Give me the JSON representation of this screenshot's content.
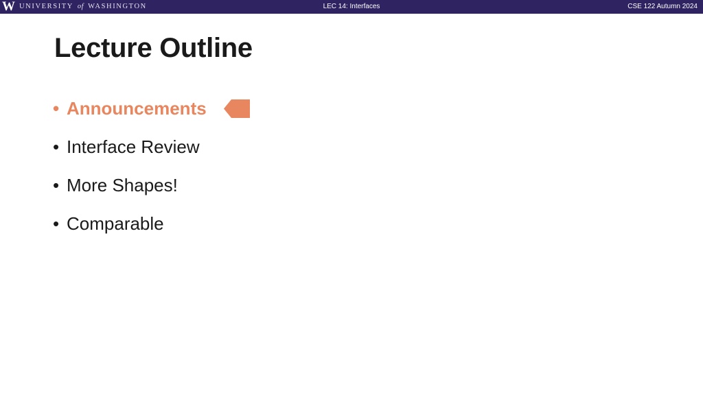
{
  "header": {
    "logo_letter": "W",
    "logo_part1": "UNIVERSITY",
    "logo_of": "of",
    "logo_part2": "WASHINGTON",
    "lecture": "LEC 14: Interfaces",
    "course": "CSE 122 Autumn 2024"
  },
  "slide": {
    "title": "Lecture Outline",
    "items": [
      {
        "label": "Announcements",
        "active": true
      },
      {
        "label": "Interface Review",
        "active": false
      },
      {
        "label": "More Shapes!",
        "active": false
      },
      {
        "label": "Comparable",
        "active": false
      }
    ]
  },
  "colors": {
    "header_bg": "#2f2461",
    "accent": "#e8875f",
    "text": "#1a1a1a"
  },
  "icons": {
    "pointer": "left-pointing-arrow-icon"
  }
}
